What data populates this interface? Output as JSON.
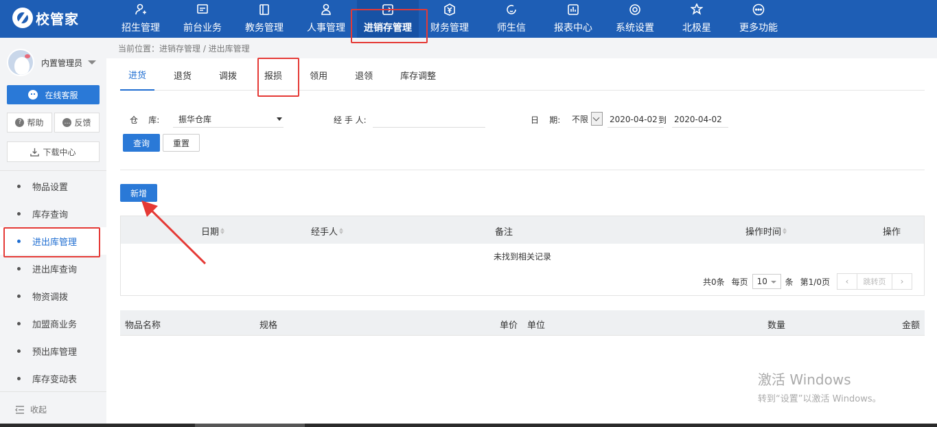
{
  "brand": {
    "name": "校管家"
  },
  "topnav": [
    {
      "label": "招生管理",
      "icon": "user-plus-icon"
    },
    {
      "label": "前台业务",
      "icon": "monitor-icon"
    },
    {
      "label": "教务管理",
      "icon": "book-icon"
    },
    {
      "label": "人事管理",
      "icon": "person-icon"
    },
    {
      "label": "进销存管理",
      "icon": "exchange-icon"
    },
    {
      "label": "财务管理",
      "icon": "yen-icon"
    },
    {
      "label": "师生信",
      "icon": "chat-icon"
    },
    {
      "label": "报表中心",
      "icon": "chart-icon"
    },
    {
      "label": "系统设置",
      "icon": "settings-icon"
    },
    {
      "label": "北极星",
      "icon": "star-icon"
    },
    {
      "label": "更多功能",
      "icon": "more-icon"
    }
  ],
  "sidebar": {
    "user": "内置管理员",
    "service": "在线客服",
    "help": "帮助",
    "feedback": "反馈",
    "download": "下载中心",
    "items": [
      {
        "label": "物品设置"
      },
      {
        "label": "库存查询"
      },
      {
        "label": "进出库管理"
      },
      {
        "label": "进出库查询"
      },
      {
        "label": "物资调拨"
      },
      {
        "label": "加盟商业务"
      },
      {
        "label": "预出库管理"
      },
      {
        "label": "库存变动表"
      }
    ],
    "collapse": "收起"
  },
  "breadcrumb": "当前位置：进销存管理 / 进出库管理",
  "tabs": [
    {
      "label": "进货"
    },
    {
      "label": "退货"
    },
    {
      "label": "调拨"
    },
    {
      "label": "报损"
    },
    {
      "label": "领用"
    },
    {
      "label": "退领"
    },
    {
      "label": "库存调整"
    }
  ],
  "filters": {
    "warehouse_label": "仓    库:",
    "warehouse_value": "振华仓库",
    "handler_label": "经 手 人:",
    "handler_value": "",
    "date_label": "日    期:",
    "date_range": "不限",
    "date_from": "2020-04-02",
    "date_to_sep": "到",
    "date_to": "2020-04-02"
  },
  "buttons": {
    "query": "查询",
    "reset": "重置",
    "add": "新增"
  },
  "table1": {
    "headers": {
      "date": "日期",
      "handler": "经手人",
      "note": "备注",
      "optime": "操作时间",
      "action": "操作"
    },
    "empty": "未找到相关记录",
    "pager": {
      "total": "共0条",
      "per_page": "每页",
      "page_size": "10",
      "unit": "条",
      "page": "第1/0页",
      "jump": "跳转页"
    }
  },
  "table2": {
    "headers": {
      "name": "物品名称",
      "spec": "规格",
      "price": "单价",
      "unit": "单位",
      "qty": "数量",
      "amount": "金额"
    }
  },
  "watermark": {
    "line1": "激活 Windows",
    "line2": "转到“设置”以激活 Windows。"
  },
  "colors": {
    "primary": "#1e5eb5",
    "accent": "#2a79d7",
    "highlight": "#e53935"
  }
}
